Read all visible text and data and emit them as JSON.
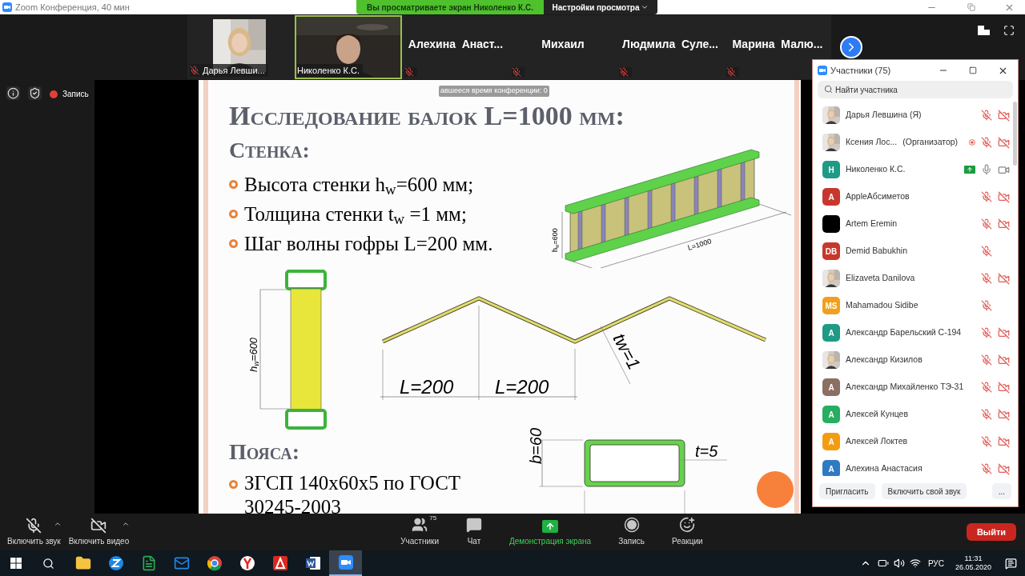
{
  "window": {
    "title": "Zoom Конференция, 40 мин"
  },
  "share_banner": {
    "text": "Вы просматриваете экран Николенко К.С.",
    "menu": "Настройки просмотра"
  },
  "video_strip": [
    {
      "name": "Дарья Левши...",
      "muted": true,
      "speaking": false
    },
    {
      "name": "Николенко К.С.",
      "kind": "video",
      "muted": false,
      "speaking": true
    },
    {
      "name": "Алехина  Анаст...",
      "kind": "name",
      "muted": true,
      "speaking": false
    },
    {
      "name": "Михаил",
      "kind": "name",
      "muted": true,
      "speaking": false
    },
    {
      "name": "Людмила  Суле...",
      "kind": "name",
      "muted": true,
      "speaking": false
    },
    {
      "name": "Марина  Малю...",
      "kind": "name",
      "muted": true,
      "speaking": false
    }
  ],
  "meeting_tools": {
    "recording_label": "Запись"
  },
  "slide": {
    "time_tooltip": "авшееся время конференции: 0",
    "heading": "Исследование балок L=1000 мм:",
    "section_1": "Стенка:",
    "bullets_1": [
      "Высота стенки h$_{w}$=600 мм;",
      "Толщина стенки t$_{w}$ =1 мм;",
      "Шаг волны гофры L=200 мм."
    ],
    "section_2": "Пояса:",
    "bullets_2": [
      "ЗГСП 140х60х5 по ГОСТ 30245-2003"
    ],
    "beam_height": {
      "symbol": "h",
      "subscript": "w",
      "value": "=600"
    },
    "beam_length": "L=1000",
    "section_height": {
      "symbol": "h",
      "subscript": "w",
      "value": "=600"
    },
    "pitch_labels": [
      "L=200",
      "L=200"
    ],
    "thickness": "tw=1",
    "tube_height": "b=60",
    "tube_wall": "t=5"
  },
  "participants_panel": {
    "title": "Участники (75)",
    "search_placeholder": "Найти участника",
    "participants": [
      {
        "name": "Дарья Левшина (Я)",
        "has_photo": true,
        "mic_muted": true,
        "camera_shown": true,
        "video_off": true,
        "sharing": false,
        "recording": false
      },
      {
        "name": "Ксения Лос...",
        "role": "(Организатор)",
        "has_photo": true,
        "mic_muted": true,
        "camera_shown": true,
        "video_off": true,
        "sharing": false,
        "recording": true
      },
      {
        "name": "Николенко К.С.",
        "has_photo": false,
        "initials": "Н",
        "color": "#1f9a85",
        "mic_muted": false,
        "camera_shown": true,
        "video_off": false,
        "sharing": true,
        "recording": false
      },
      {
        "name": "AppleАбсиметов",
        "has_photo": false,
        "initials": "A",
        "color": "#c8372d",
        "mic_muted": true,
        "camera_shown": true,
        "video_off": true,
        "sharing": false,
        "recording": false
      },
      {
        "name": "Artem Eremin",
        "has_photo": false,
        "color": "#000000",
        "mic_muted": true,
        "camera_shown": true,
        "video_off": true,
        "sharing": false,
        "recording": false
      },
      {
        "name": "Demid Babukhin",
        "has_photo": false,
        "initials": "DB",
        "color": "#c8372d",
        "mic_muted": true,
        "camera_shown": false,
        "sharing": false,
        "recording": false
      },
      {
        "name": "Elizaveta Danilova",
        "has_photo": true,
        "mic_muted": true,
        "camera_shown": true,
        "video_off": true,
        "sharing": false,
        "recording": false
      },
      {
        "name": "Mahamadou Sidibe",
        "has_photo": false,
        "initials": "MS",
        "color": "#f0a01e",
        "mic_muted": true,
        "camera_shown": false,
        "sharing": false,
        "recording": false
      },
      {
        "name": "Александр Барельский С-194",
        "has_photo": false,
        "initials": "A",
        "color": "#1f9a85",
        "mic_muted": true,
        "camera_shown": true,
        "video_off": true,
        "sharing": false,
        "recording": false
      },
      {
        "name": "Александр Кизилов",
        "has_photo": true,
        "mic_muted": true,
        "camera_shown": true,
        "video_off": true,
        "sharing": false,
        "recording": false
      },
      {
        "name": "Александр Михайленко ТЭ-31",
        "has_photo": false,
        "initials": "A",
        "color": "#8d6e63",
        "mic_muted": true,
        "camera_shown": true,
        "video_off": true,
        "sharing": false,
        "recording": false
      },
      {
        "name": "Алексей Кунцев",
        "has_photo": false,
        "initials": "A",
        "color": "#27ae60",
        "mic_muted": true,
        "camera_shown": true,
        "video_off": true,
        "sharing": false,
        "recording": false
      },
      {
        "name": "Алексей Локтев",
        "has_photo": false,
        "initials": "A",
        "color": "#f39c12",
        "mic_muted": true,
        "camera_shown": true,
        "video_off": true,
        "sharing": false,
        "recording": false
      },
      {
        "name": "Алехина Анастасия",
        "has_photo": false,
        "initials": "A",
        "color": "#2e7bc4",
        "mic_muted": true,
        "camera_shown": true,
        "video_off": true,
        "sharing": false,
        "recording": false
      }
    ],
    "buttons": [
      "Пригласить",
      "Включить свой звук",
      "..."
    ]
  },
  "toolbar": {
    "left": [
      {
        "label": "Включить звук",
        "kind": "mic"
      },
      {
        "label": "Включить видео",
        "kind": "video"
      }
    ],
    "center": [
      {
        "label": "Участники",
        "kind": "participants",
        "count": "75",
        "active": false
      },
      {
        "label": "Чат",
        "kind": "chat",
        "active": false
      },
      {
        "label": "Демонстрация экрана",
        "kind": "share",
        "active": true
      },
      {
        "label": "Запись",
        "kind": "record",
        "active": false
      },
      {
        "label": "Реакции",
        "kind": "reactions",
        "active": false
      }
    ],
    "leave": "Выйти"
  },
  "taskbar": {
    "apps": [
      {
        "kind": "explorer",
        "active": false
      },
      {
        "kind": "z",
        "active": false
      },
      {
        "kind": "notes",
        "active": false
      },
      {
        "kind": "mail",
        "active": false
      },
      {
        "kind": "chrome",
        "active": false
      },
      {
        "kind": "yandex",
        "active": false
      },
      {
        "kind": "acrobat",
        "active": false
      },
      {
        "kind": "word",
        "active": false
      },
      {
        "kind": "zoom",
        "active": true
      }
    ],
    "language": "РУС",
    "time": "11:31",
    "date": "26.05.2020"
  }
}
